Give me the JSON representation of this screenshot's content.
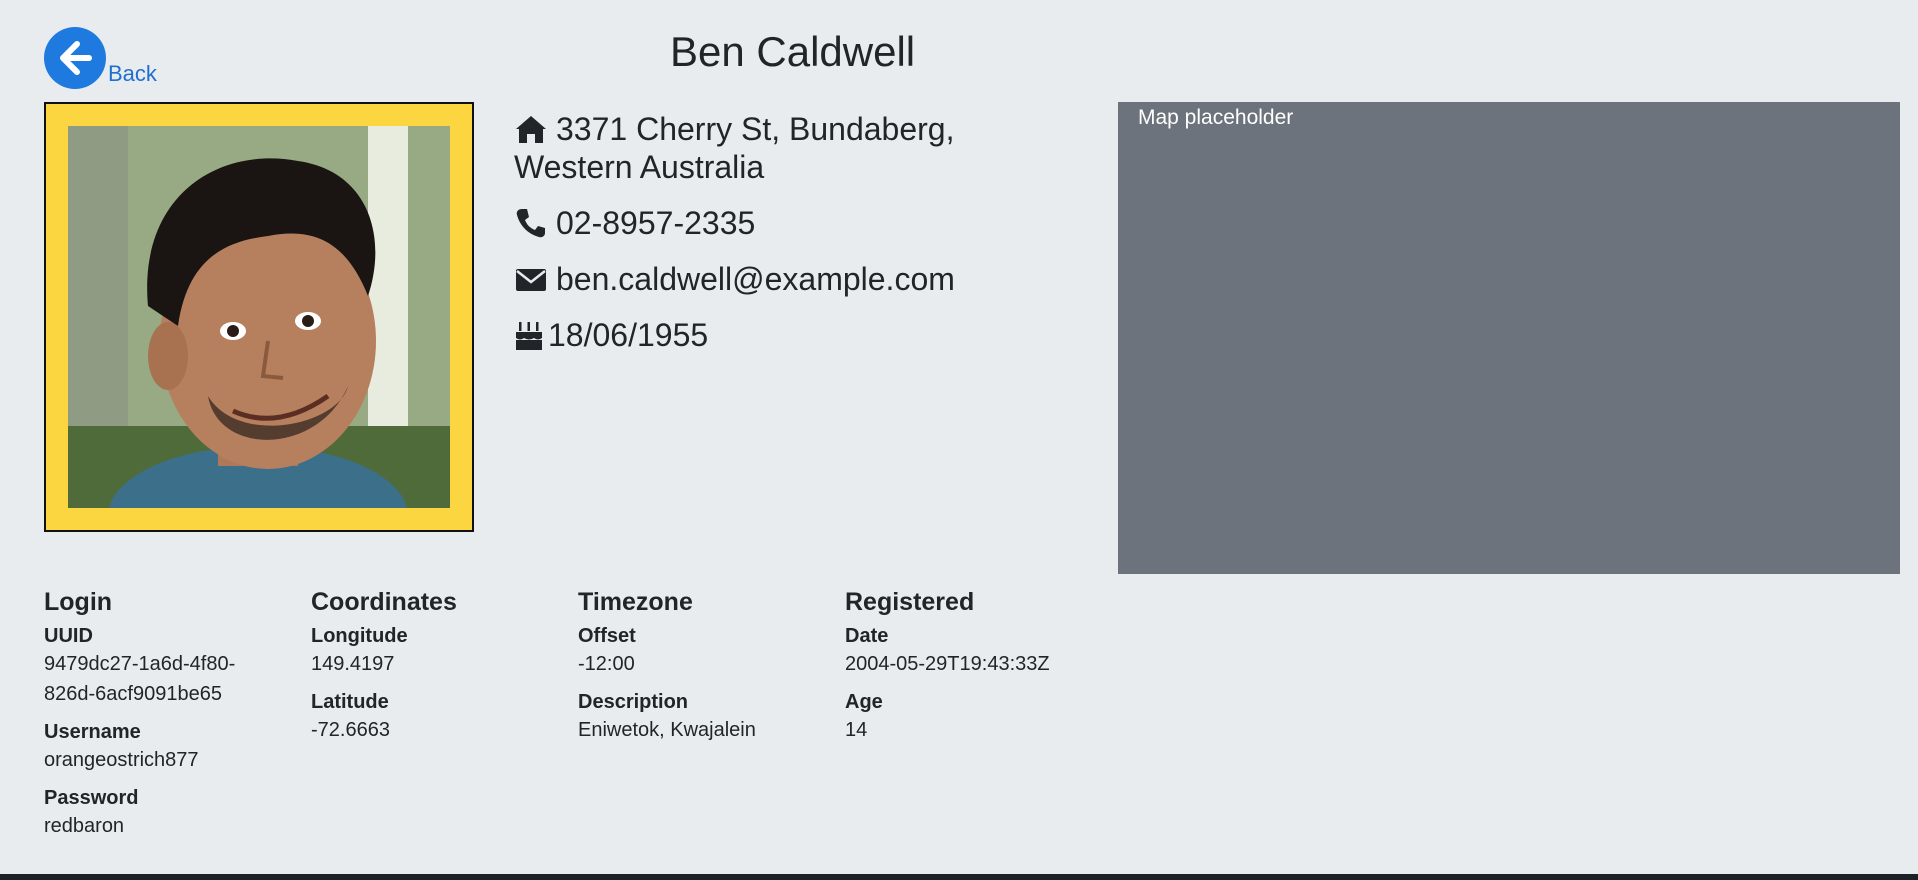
{
  "nav": {
    "back_label": "Back"
  },
  "profile": {
    "name": "Ben Caldwell",
    "address_line1": "3371 Cherry St, Bundaberg,",
    "address_line2": "Western Australia",
    "phone": "02-8957-2335",
    "email": "ben.caldwell@example.com",
    "birthday": "18/06/1955",
    "photo_frame_color": "#fbd641"
  },
  "map": {
    "label": "Map placeholder"
  },
  "login": {
    "heading": "Login",
    "uuid_label": "UUID",
    "uuid": "9479dc27-1a6d-4f80-826d-6acf9091be65",
    "username_label": "Username",
    "username": "orangeostrich877",
    "password_label": "Password",
    "password": "redbaron"
  },
  "coordinates": {
    "heading": "Coordinates",
    "longitude_label": "Longitude",
    "longitude": "149.4197",
    "latitude_label": "Latitude",
    "latitude": "-72.6663"
  },
  "timezone": {
    "heading": "Timezone",
    "offset_label": "Offset",
    "offset": "-12:00",
    "description_label": "Description",
    "description": "Eniwetok, Kwajalein"
  },
  "registered": {
    "heading": "Registered",
    "date_label": "Date",
    "date": "2004-05-29T19:43:33Z",
    "age_label": "Age",
    "age": "14"
  },
  "icons": {
    "back": "arrow-left-circle-icon",
    "address": "home-icon",
    "phone": "phone-icon",
    "email": "envelope-icon",
    "birthday": "birthday-cake-icon"
  },
  "colors": {
    "accent": "#1f7ae0",
    "background": "#e9ecef",
    "map": "#6c737c"
  }
}
